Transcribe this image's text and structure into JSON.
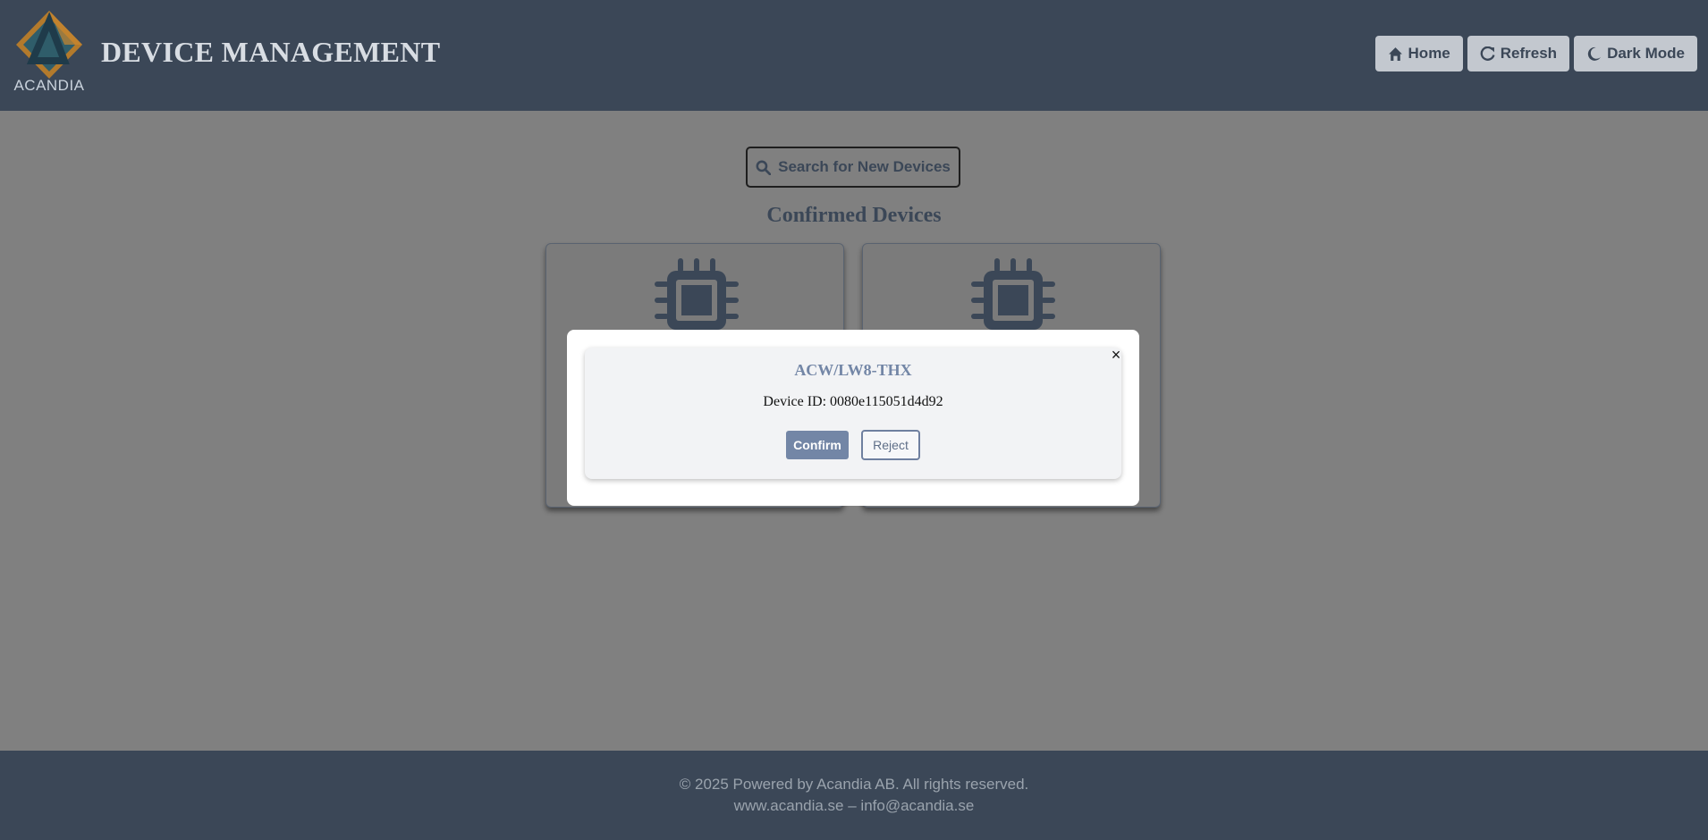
{
  "header": {
    "logo_text": "ACANDIA",
    "title": "DEVICE MANAGEMENT",
    "nav": [
      {
        "label": "Home",
        "icon": "home-icon"
      },
      {
        "label": "Refresh",
        "icon": "refresh-icon"
      },
      {
        "label": "Dark Mode",
        "icon": "moon-icon"
      }
    ]
  },
  "main": {
    "search_button_label": "Search for New Devices",
    "section_title": "Confirmed Devices"
  },
  "modal": {
    "title": "ACW/LW8-THX",
    "device_id_text": "Device ID: 0080e115051d4d92",
    "confirm_label": "Confirm",
    "reject_label": "Reject",
    "close_symbol": "×"
  },
  "footer": {
    "line1": "© 2025 Powered by Acandia AB. All rights reserved.",
    "line2": "www.acandia.se – info@acandia.se"
  },
  "colors": {
    "header_bg": "#3b4757",
    "accent": "#7386a6",
    "overlay": "#808080"
  }
}
